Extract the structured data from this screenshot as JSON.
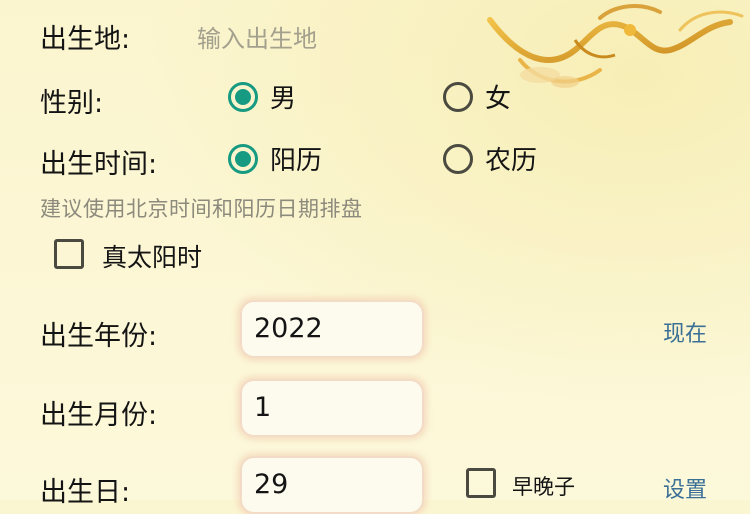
{
  "birthplace": {
    "label": "出生地:",
    "placeholder": "输入出生地"
  },
  "gender": {
    "label": "性别:",
    "options": [
      {
        "label": "男",
        "checked": true
      },
      {
        "label": "女",
        "checked": false
      }
    ]
  },
  "birth_time": {
    "label": "出生时间:",
    "options": [
      {
        "label": "阳历",
        "checked": true
      },
      {
        "label": "农历",
        "checked": false
      }
    ]
  },
  "hint": "建议使用北京时间和阳历日期排盘",
  "true_solar_time": {
    "label": "真太阳时",
    "checked": false
  },
  "birth_year": {
    "label": "出生年份:",
    "value": "2022",
    "action": "现在"
  },
  "birth_month": {
    "label": "出生月份:",
    "value": "1"
  },
  "birth_day": {
    "label": "出生日:",
    "value": "29",
    "early_late_zi": {
      "label": "早晚子",
      "checked": false
    },
    "action": "设置"
  },
  "colors": {
    "accent": "#179a82",
    "link": "#3a6f96",
    "background": "#fbf6d2"
  },
  "decoration": {
    "icon": "phoenix-illustration"
  }
}
